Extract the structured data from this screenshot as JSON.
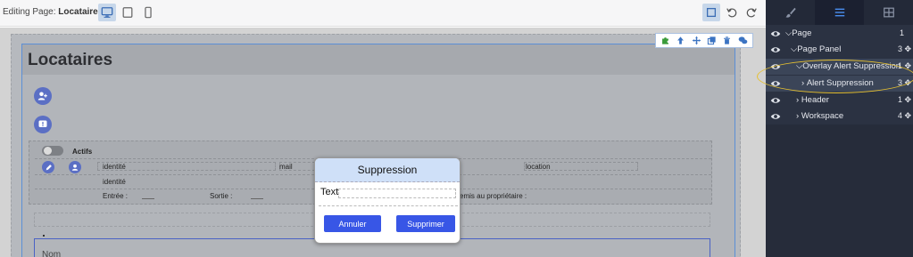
{
  "toolbar": {
    "editing_prefix": "Editing Page:",
    "page_name": "Locataires"
  },
  "canvas": {
    "panel_title": "Locataires",
    "table": {
      "toggle_label": "Actifs",
      "col_identite": "identité",
      "col_mail": "mail",
      "col_location": "location",
      "row2_identite": "identité",
      "entree_label": "Entrée :",
      "sortie_label": "Sortie :",
      "remis_label": "emis au propriétaire :"
    },
    "nom_label": "Nom"
  },
  "modal": {
    "title": "Suppression",
    "text": "Text",
    "cancel_label": "Annuler",
    "confirm_label": "Supprimer"
  },
  "tree": {
    "items": [
      {
        "label": "Page",
        "count": "1",
        "expanded": true
      },
      {
        "label": "Page Panel",
        "count": "3",
        "expanded": true
      },
      {
        "label": "Overlay Alert Suppression",
        "count": "1",
        "expanded": true
      },
      {
        "label": "Alert Suppression",
        "count": "3",
        "expanded": false
      },
      {
        "label": "Header",
        "count": "1",
        "expanded": false
      },
      {
        "label": "Workspace",
        "count": "4",
        "expanded": false
      }
    ]
  },
  "colors": {
    "accent": "#3856e6",
    "modal_header": "#cfe0f8",
    "sidebar_bg": "#2b3242",
    "highlight": "#e6c030"
  }
}
